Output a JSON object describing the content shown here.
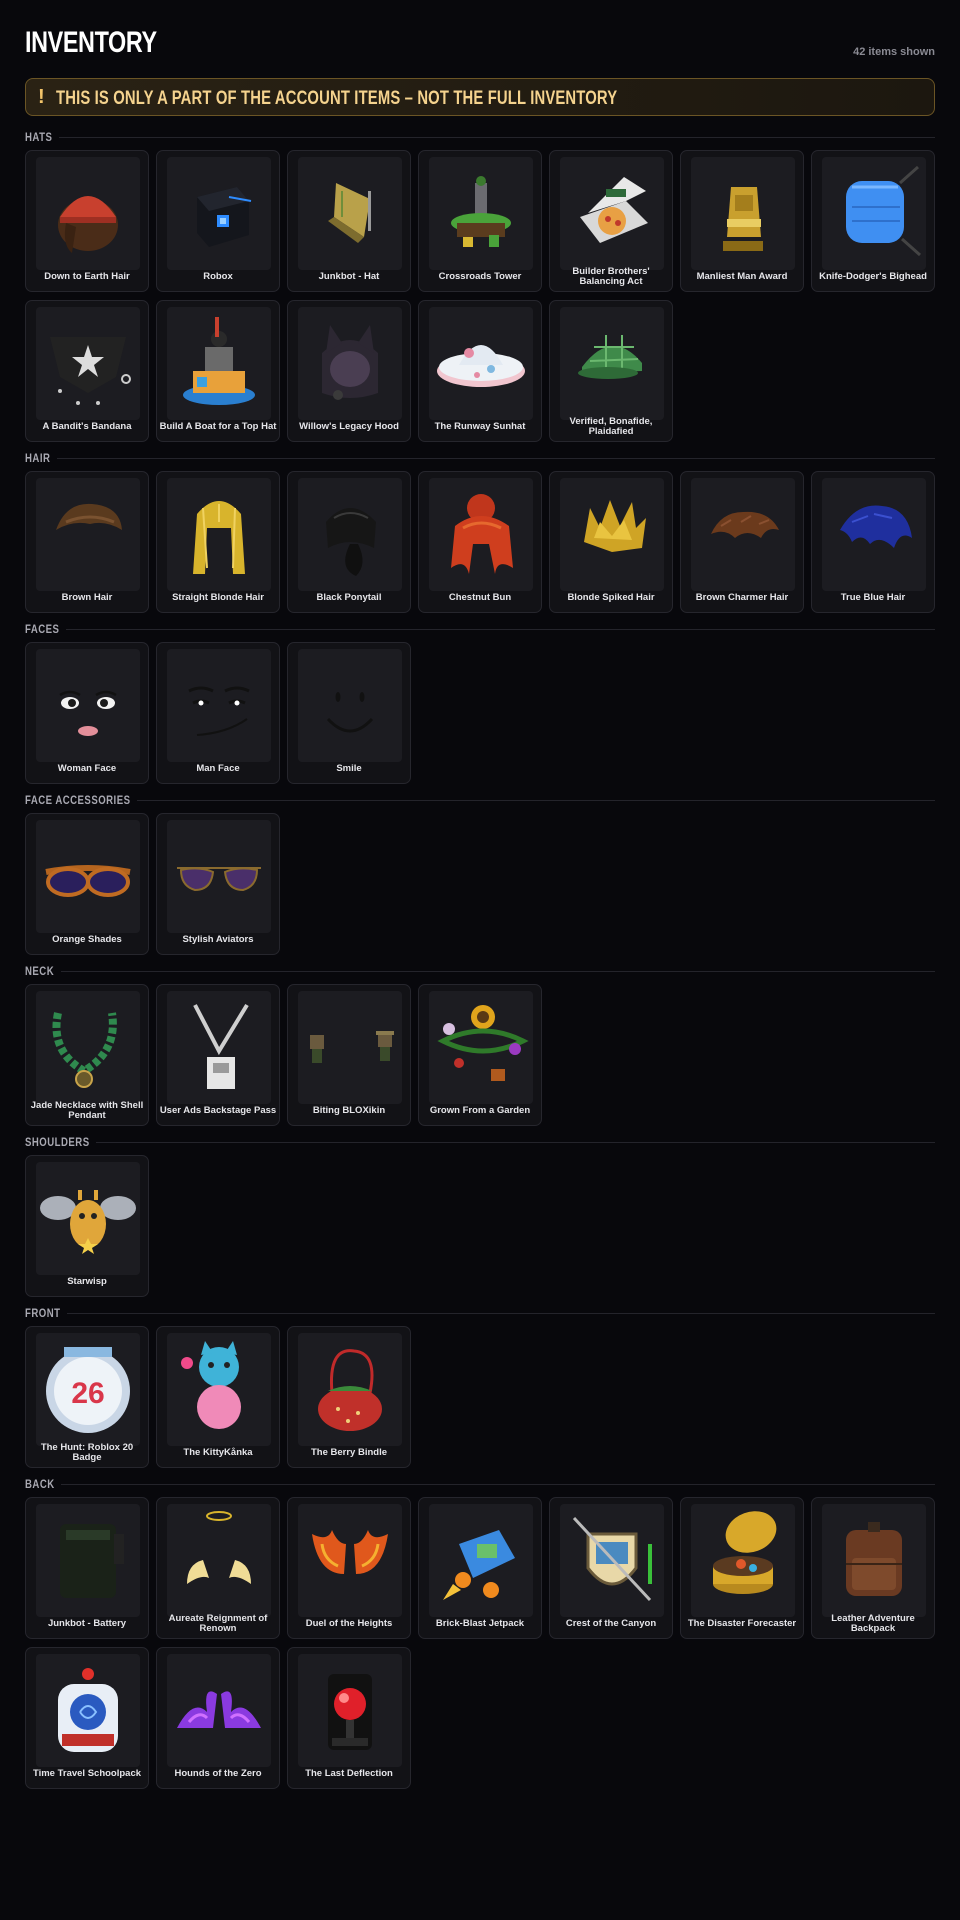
{
  "page": {
    "title": "INVENTORY",
    "count_text": "42 items shown",
    "banner_icon": "!",
    "banner_text": "THIS IS ONLY A PART OF THE ACCOUNT ITEMS – NOT THE FULL INVENTORY"
  },
  "colors": {
    "background": "#08080c",
    "card": "#121216",
    "accent": "#f5d38e",
    "banner_border": "#6b5525"
  },
  "sections": [
    {
      "title": "HATS",
      "items": [
        {
          "name": "Down to Earth Hair",
          "icon": "red-beanie-hair-icon"
        },
        {
          "name": "Robox",
          "icon": "robox-cube-icon"
        },
        {
          "name": "Junkbot - Hat",
          "icon": "junkbot-hat-icon"
        },
        {
          "name": "Crossroads Tower",
          "icon": "tower-icon"
        },
        {
          "name": "Builder Brothers' Balancing Act",
          "icon": "pizza-box-icon"
        },
        {
          "name": "Manliest Man Award",
          "icon": "trophy-icon"
        },
        {
          "name": "Knife-Dodger's Bighead",
          "icon": "blue-bighead-icon"
        },
        {
          "name": "A Bandit's Bandana",
          "icon": "bandana-icon"
        },
        {
          "name": "Build A Boat for a Top Hat",
          "icon": "boat-hat-icon"
        },
        {
          "name": "Willow's Legacy Hood",
          "icon": "cat-hood-icon"
        },
        {
          "name": "The Runway Sunhat",
          "icon": "sunhat-icon"
        },
        {
          "name": "Verified, Bonafide, Plaidafied",
          "icon": "plaid-cap-icon"
        }
      ]
    },
    {
      "title": "HAIR",
      "items": [
        {
          "name": "Brown Hair",
          "icon": "brown-hair-icon"
        },
        {
          "name": "Straight Blonde Hair",
          "icon": "blonde-hair-icon"
        },
        {
          "name": "Black Ponytail",
          "icon": "black-ponytail-icon"
        },
        {
          "name": "Chestnut Bun",
          "icon": "chestnut-bun-icon"
        },
        {
          "name": "Blonde Spiked Hair",
          "icon": "spiked-hair-icon"
        },
        {
          "name": "Brown Charmer Hair",
          "icon": "charmer-hair-icon"
        },
        {
          "name": "True Blue Hair",
          "icon": "blue-hair-icon"
        }
      ]
    },
    {
      "title": "FACES",
      "items": [
        {
          "name": "Woman Face",
          "icon": "woman-face-icon"
        },
        {
          "name": "Man Face",
          "icon": "man-face-icon"
        },
        {
          "name": "Smile",
          "icon": "smile-face-icon"
        }
      ]
    },
    {
      "title": "FACE ACCESSORIES",
      "items": [
        {
          "name": "Orange Shades",
          "icon": "orange-shades-icon"
        },
        {
          "name": "Stylish Aviators",
          "icon": "aviators-icon"
        }
      ]
    },
    {
      "title": "NECK",
      "items": [
        {
          "name": "Jade Necklace with Shell Pendant",
          "icon": "jade-necklace-icon"
        },
        {
          "name": "User Ads Backstage Pass",
          "icon": "backstage-pass-icon"
        },
        {
          "name": "Biting BLOXikin",
          "icon": "bloxikin-icon"
        },
        {
          "name": "Grown From a Garden",
          "icon": "garden-icon"
        }
      ]
    },
    {
      "title": "SHOULDERS",
      "items": [
        {
          "name": "Starwisp",
          "icon": "starwisp-icon"
        }
      ]
    },
    {
      "title": "FRONT",
      "items": [
        {
          "name": "The Hunt: Roblox 20 Badge",
          "icon": "hunt-badge-icon",
          "badge_number": "26"
        },
        {
          "name": "The KittyKånka",
          "icon": "kitty-plush-icon"
        },
        {
          "name": "The Berry Bindle",
          "icon": "berry-bag-icon"
        }
      ]
    },
    {
      "title": "BACK",
      "items": [
        {
          "name": "Junkbot - Battery",
          "icon": "battery-icon"
        },
        {
          "name": "Aureate Reignment of Renown",
          "icon": "golden-wings-icon"
        },
        {
          "name": "Duel of the Heights",
          "icon": "fire-wings-icon"
        },
        {
          "name": "Brick-Blast Jetpack",
          "icon": "jetpack-icon"
        },
        {
          "name": "Crest of the Canyon",
          "icon": "crest-shield-icon"
        },
        {
          "name": "The Disaster Forecaster",
          "icon": "forecaster-icon"
        },
        {
          "name": "Leather Adventure Backpack",
          "icon": "leather-backpack-icon"
        },
        {
          "name": "Time Travel Schoolpack",
          "icon": "schoolpack-icon"
        },
        {
          "name": "Hounds of the Zero",
          "icon": "hounds-icon"
        },
        {
          "name": "The Last Deflection",
          "icon": "deflection-icon"
        }
      ]
    }
  ]
}
